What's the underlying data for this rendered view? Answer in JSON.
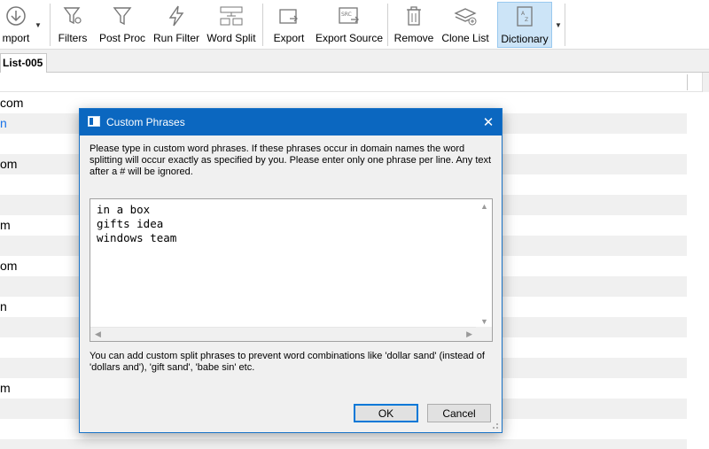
{
  "toolbar": {
    "import_label": "mport",
    "filters_label": "Filters",
    "post_proc_label": "Post Proc",
    "run_filter_label": "Run Filter",
    "word_split_label": "Word Split",
    "export_label": "Export",
    "export_source_label": "Export Source",
    "remove_label": "Remove",
    "clone_list_label": "Clone List",
    "dictionary_label": "Dictionary"
  },
  "tab": {
    "label": "List-005"
  },
  "grid": {
    "rows": [
      {
        "text": "com"
      },
      {
        "text": "n"
      },
      {
        "text": ""
      },
      {
        "text": "om"
      },
      {
        "text": ""
      },
      {
        "text": ""
      },
      {
        "text": "m"
      },
      {
        "text": ""
      },
      {
        "text": "om"
      },
      {
        "text": ""
      },
      {
        "text": "n"
      },
      {
        "text": ""
      },
      {
        "text": ""
      },
      {
        "text": ""
      },
      {
        "text": "m"
      },
      {
        "text": ""
      },
      {
        "text": ""
      },
      {
        "text": ""
      }
    ]
  },
  "dialog": {
    "title": "Custom Phrases",
    "close_glyph": "✕",
    "description": "Please type in custom word phrases. If these phrases occur in domain names the word splitting will occur exactly as specified by you. Please enter only one phrase per line. Any text after a # will be ignored.",
    "phrases_text": "in a box\ngifts idea\nwindows team",
    "note": "You can add custom split phrases to prevent word combinations like 'dollar sand' (instead of 'dollars and'), 'gift sand', 'babe sin' etc.",
    "ok_label": "OK",
    "cancel_label": "Cancel"
  },
  "colors": {
    "titlebar": "#0b67c0",
    "active_button": "#cce4f7",
    "link_text": "#1a73e8"
  }
}
